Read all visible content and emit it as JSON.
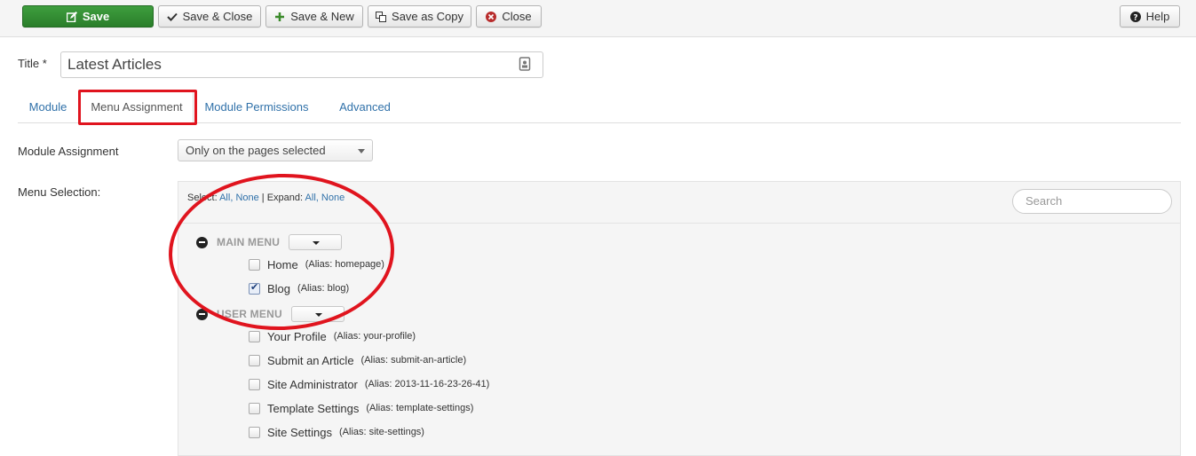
{
  "toolbar": {
    "save": "Save",
    "save_close": "Save & Close",
    "save_new": "Save & New",
    "save_copy": "Save as Copy",
    "close": "Close",
    "help": "Help"
  },
  "title_field": {
    "label": "Title *",
    "value": "Latest Articles"
  },
  "tabs": [
    "Module",
    "Menu Assignment",
    "Module Permissions",
    "Advanced"
  ],
  "active_tab": "Menu Assignment",
  "module_assignment": {
    "label": "Module Assignment",
    "selected": "Only on the pages selected"
  },
  "menu_selection": {
    "label": "Menu Selection:",
    "select_label": "Select:",
    "select_all": "All,",
    "select_none": "None",
    "sep": "|",
    "expand_label": "Expand:",
    "expand_all": "All,",
    "expand_none": "None",
    "search_placeholder": "Search",
    "menus": [
      {
        "title": "MAIN MENU",
        "items": [
          {
            "label": "Home",
            "alias": "(Alias: homepage)",
            "checked": false
          },
          {
            "label": "Blog",
            "alias": "(Alias: blog)",
            "checked": true
          }
        ]
      },
      {
        "title": "USER MENU",
        "items": [
          {
            "label": "Your Profile",
            "alias": "(Alias: your-profile)",
            "checked": false
          },
          {
            "label": "Submit an Article",
            "alias": "(Alias: submit-an-article)",
            "checked": false
          },
          {
            "label": "Site Administrator",
            "alias": "(Alias: 2013-11-16-23-26-41)",
            "checked": false
          },
          {
            "label": "Template Settings",
            "alias": "(Alias: template-settings)",
            "checked": false
          },
          {
            "label": "Site Settings",
            "alias": "(Alias: site-settings)",
            "checked": false
          }
        ]
      }
    ]
  },
  "colors": {
    "save_green": "#2a7e2a",
    "link_blue": "#3071a9",
    "annotation_red": "#e0141e"
  }
}
